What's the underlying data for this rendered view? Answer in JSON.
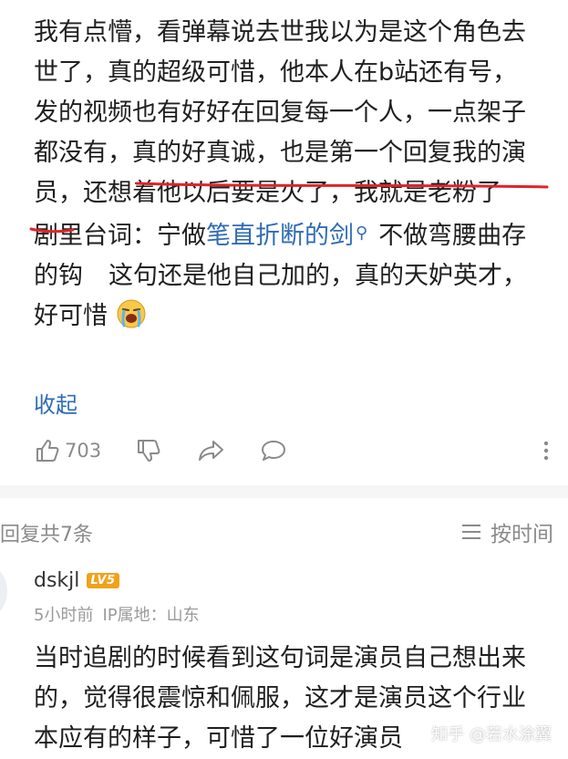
{
  "comment": {
    "lines": [
      "我有点懵，看弹幕说去世我以为是这个角色去",
      "世了，真的超级可惜，他本人在b站还有号，",
      "发的视频也有好好在回复每一个人，一点架子",
      "都没有，真的好真诚，也是第一个回复我的演",
      "员，还想着他以后要是火了，我就是老粉了"
    ],
    "line6_prefix": "剧里台词：宁做",
    "line6_link": "笔直折断的剑",
    "line6_suffix": "不做弯腰曲存",
    "line7_a": "的钩",
    "line7_b": "这句还是他自己加的，真的天妒英才，",
    "line8": "好可惜",
    "collapse_label": "收起"
  },
  "actions": {
    "like_count": "703",
    "icons": [
      "thumb-up-icon",
      "thumb-down-icon",
      "share-icon",
      "comment-icon",
      "more-icon"
    ]
  },
  "replies": {
    "count_label": "回复共7条",
    "sort_label": "按时间"
  },
  "reply": {
    "username": "dskjl",
    "level": "LV5",
    "time": "5小时前",
    "ip_location": "IP属地：山东",
    "lines": [
      "当时追剧的时候看到这句词是演员自己想出来",
      "的，觉得很震惊和佩服，这才是演员这个行业",
      "本应有的样子，可惜了一位好演员"
    ]
  },
  "watermark": "知乎 @若水涂翼",
  "colors": {
    "link": "#2f6cb5",
    "annotation_red": "#e0232b",
    "muted": "#8a8a8a",
    "level_badge": "#f0a21b"
  }
}
